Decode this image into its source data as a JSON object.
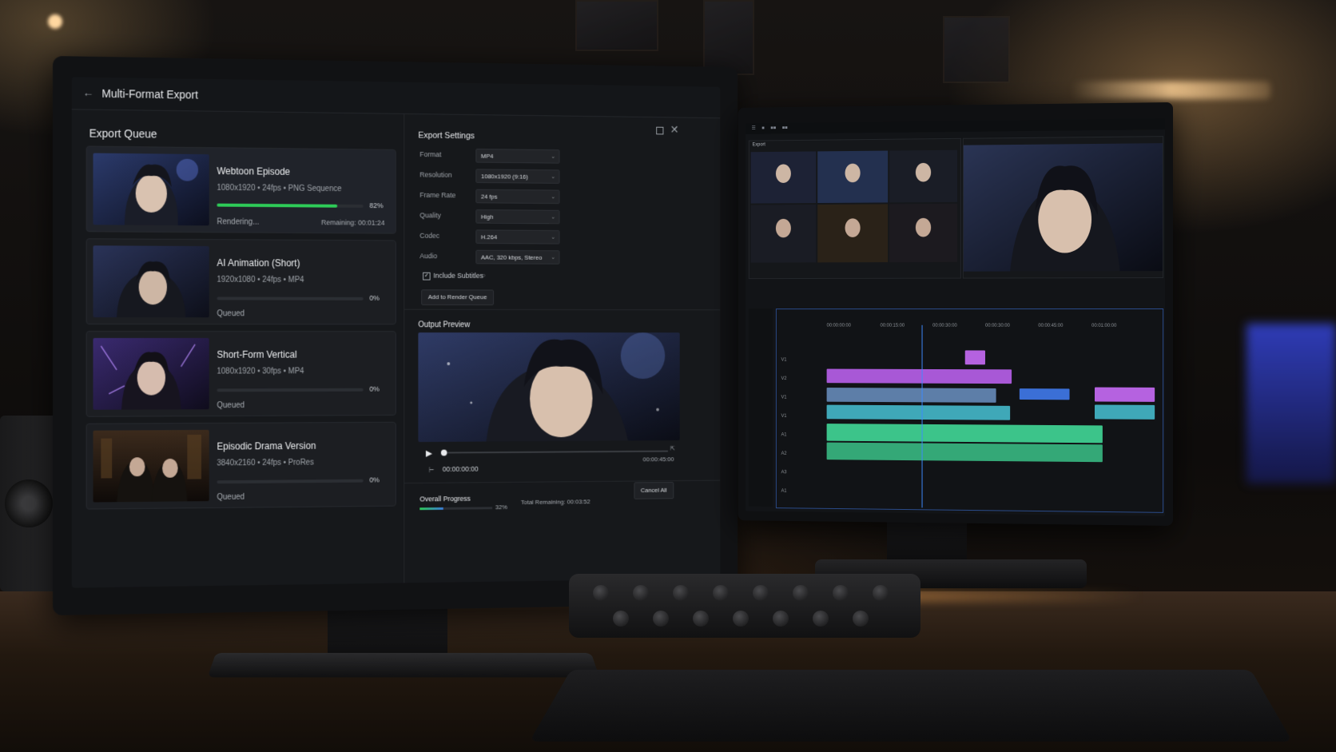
{
  "window": {
    "title": "Multi-Format Export"
  },
  "queue": {
    "title": "Export Queue",
    "items": [
      {
        "name": "Webtoon Episode",
        "meta": "1080x1920 • 24fps • PNG Sequence",
        "progress": 0.82,
        "percent": "82%",
        "status": "Rendering...",
        "remaining": "Remaining: 00:01:24"
      },
      {
        "name": "AI Animation (Short)",
        "meta": "1920x1080 • 24fps • MP4",
        "progress": 0,
        "percent": "0%",
        "status": "Queued",
        "remaining": ""
      },
      {
        "name": "Short-Form Vertical",
        "meta": "1080x1920 • 30fps • MP4",
        "progress": 0,
        "percent": "0%",
        "status": "Queued",
        "remaining": ""
      },
      {
        "name": "Episodic Drama Version",
        "meta": "3840x2160 • 24fps • ProRes",
        "progress": 0,
        "percent": "0%",
        "status": "Queued",
        "remaining": ""
      }
    ]
  },
  "settings": {
    "title": "Export Settings",
    "fields": [
      {
        "label": "Format",
        "value": "MP4"
      },
      {
        "label": "Resolution",
        "value": "1080x1920 (9:16)"
      },
      {
        "label": "Frame Rate",
        "value": "24 fps"
      },
      {
        "label": "Quality",
        "value": "High"
      },
      {
        "label": "Codec",
        "value": "H.264"
      },
      {
        "label": "Audio",
        "value": "AAC, 320 kbps, Stereo"
      }
    ],
    "subtitles_label": "Include Subtitles",
    "subtitles_checked": true,
    "add_button": "Add to Render Queue"
  },
  "preview": {
    "title": "Output Preview",
    "timecode": "00:00:00:00",
    "duration": "00:00:45:00"
  },
  "overall": {
    "label": "Overall Progress",
    "progress": 0.32,
    "percent": "32%",
    "total_remaining": "Total Remaining:  00:03:52",
    "cancel_button": "Cancel All"
  },
  "editor": {
    "source_label": "Export",
    "timeline_ruler": [
      "00:00:00:00",
      "00:00:15:00",
      "00:00:30:00",
      "00:00:30:00",
      "00:00:45:00",
      "00:01:00:00"
    ],
    "tracks": [
      "V1",
      "V2",
      "V1",
      "V1",
      "A1",
      "A2",
      "A3",
      "A1"
    ]
  },
  "colors": {
    "progress_green": "#2ecc58",
    "accent_blue": "#3d8bff",
    "clip_purple": "#b562e0",
    "clip_teal": "#3fa8b8",
    "audio_green": "#3cc48a"
  }
}
